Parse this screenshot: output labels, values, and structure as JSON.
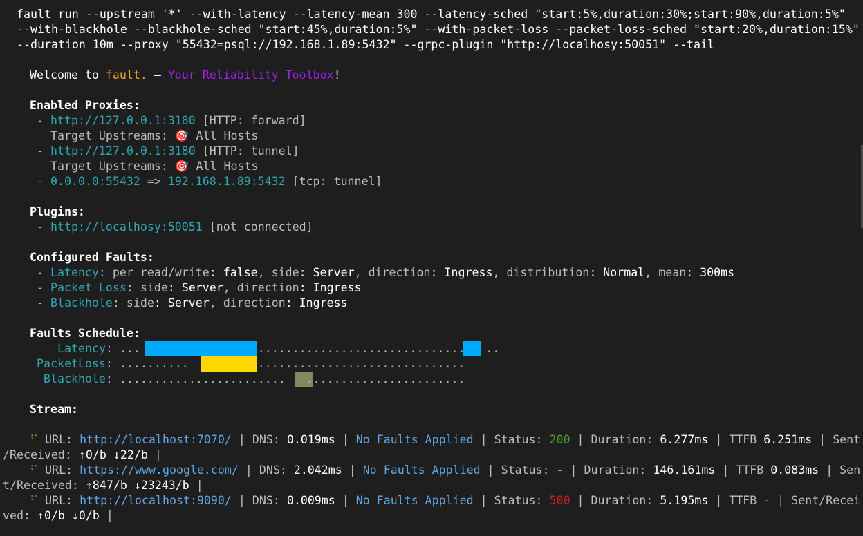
{
  "command": {
    "line1": "fault run --upstream '*' --with-latency --latency-mean 300 --latency-sched \"start:5%,duration:30%;start:90%,duration:5%\"",
    "line2": "--with-blackhole --blackhole-sched \"start:45%,duration:5%\" --with-packet-loss --packet-loss-sched \"start:20%,duration:15%\"",
    "line3": "--duration 10m --proxy \"55432=psql://192.168.1.89:5432\" --grpc-plugin \"http://localhosy:50051\" --tail"
  },
  "welcome": {
    "prefix": "Welcome to ",
    "brand": "fault.",
    "dash": " — ",
    "tagline_a": "Your Reliability ",
    "tagline_b": "Toolbox",
    "suffix": "!"
  },
  "proxies": {
    "heading": "Enabled Proxies:",
    "items": [
      {
        "addr": "http://127.0.0.1:3180",
        "mode": " [HTTP: forward]",
        "target_label": "Target Upstreams: ",
        "target_icon": "🎯",
        "target_value": " All Hosts"
      },
      {
        "addr": "http://127.0.0.1:3180",
        "mode": " [HTTP: tunnel]",
        "target_label": "Target Upstreams: ",
        "target_icon": "🎯",
        "target_value": " All Hosts"
      }
    ],
    "tcp": {
      "from": "0.0.0.0:55432",
      "arrow": " => ",
      "to": "192.168.1.89:5432",
      "mode": " [tcp: tunnel]"
    }
  },
  "plugins": {
    "heading": "Plugins:",
    "items": [
      {
        "addr": "http://localhosy:50051",
        "status": " [not connected]"
      }
    ]
  },
  "faults": {
    "heading": "Configured Faults:",
    "latency": {
      "name": "Latency",
      "k1": ": per read/write",
      "v1": ": false",
      "k2": ", side",
      "v2": ": Server",
      "k3": ", direction",
      "v3": ": Ingress",
      "k4": ", distribution",
      "v4": ": Normal",
      "k5": ", mean",
      "v5": ": 300ms"
    },
    "packet_loss": {
      "name": "Packet Loss",
      "k1": ": side",
      "v1": ": Server",
      "k2": ", direction",
      "v2": ": Ingress"
    },
    "blackhole": {
      "name": "Blackhole",
      "k1": ": side",
      "v1": ": Server",
      "k2": ", direction",
      "v2": ": Ingress"
    }
  },
  "schedule": {
    "heading": "Faults Schedule:",
    "latency_label": "Latency",
    "packetloss_label": "PacketLoss",
    "blackhole_label": "Blackhole",
    "colon": ":",
    "latency_dots": " ...                 ..............................   ..",
    "packetloss_dots": " ..........         ...............................",
    "blackhole_dots": " ........................   .......................",
    "colors": {
      "latency": "#00aaff",
      "packetloss": "#ffd700",
      "blackhole": "#87875f"
    },
    "windows": {
      "latency": [
        {
          "start": 0.05,
          "duration": 0.3
        },
        {
          "start": 0.9,
          "duration": 0.05
        }
      ],
      "packetloss": [
        {
          "start": 0.2,
          "duration": 0.15
        }
      ],
      "blackhole": [
        {
          "start": 0.45,
          "duration": 0.05
        }
      ]
    }
  },
  "stream": {
    "heading": "Stream:",
    "spinner": "⠋",
    "url_label": " URL: ",
    "sep": " | ",
    "dns_label": "DNS: ",
    "no_faults": "No Faults Applied",
    "status_label": "Status: ",
    "duration_label": "Duration: ",
    "ttfb_label": "TTFB ",
    "rows": [
      {
        "url": "http://localhost:7070/",
        "dns": "0.019ms",
        "status": "200",
        "duration": "6.277ms",
        "ttfb": "6.251ms",
        "tail_a": " | Sent",
        "wrap_label": "/Received: ",
        "sent": "↑0/b",
        "recv": "↓22/b",
        "end": " |"
      },
      {
        "url": "https://www.google.com/",
        "dns": "2.042ms",
        "status": "-",
        "duration": "146.161ms",
        "ttfb": "0.083ms",
        "tail_a": " | Sen",
        "wrap_label": "t/Received: ",
        "sent": "↑847/b",
        "recv": "↓23243/b",
        "end": " |"
      },
      {
        "url": "http://localhost:9090/",
        "dns": "0.009ms",
        "status": "500",
        "duration": "5.195ms",
        "ttfb": "-",
        "tail_a": " | Sent/Recei",
        "wrap_label": "ved: ",
        "sent": "↑0/b",
        "recv": "↓0/b",
        "end": " |"
      }
    ]
  }
}
